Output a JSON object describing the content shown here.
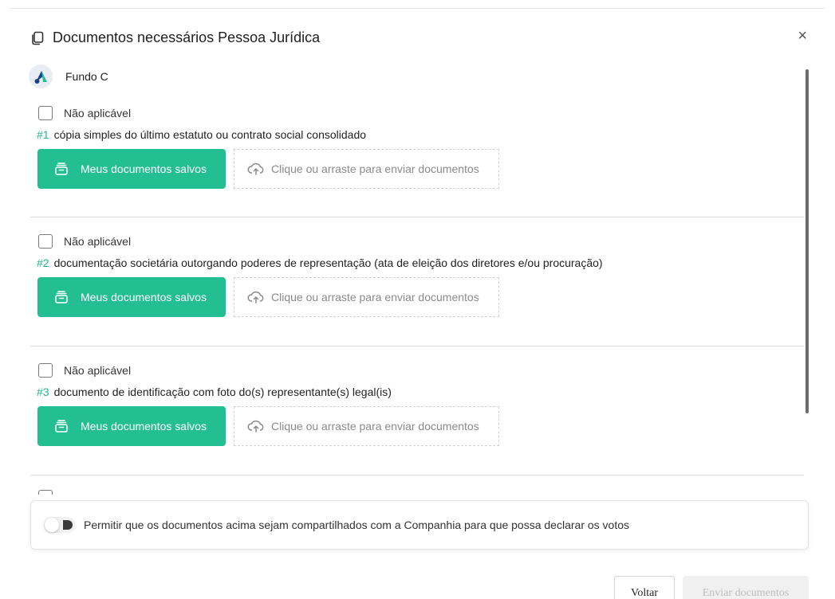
{
  "modal": {
    "title": "Documentos necessários Pessoa Jurídica",
    "close_label": "×"
  },
  "fund": {
    "name": "Fundo C"
  },
  "documents": [
    {
      "not_applicable_label": "Não aplicável",
      "number": "#1",
      "description": "cópia simples do último estatuto ou contrato social consolidado",
      "saved_button_label": "Meus documentos salvos",
      "upload_label": "Clique ou arraste para enviar documentos"
    },
    {
      "not_applicable_label": "Não aplicável",
      "number": "#2",
      "description": "documentação societária outorgando poderes de representação (ata de eleição dos diretores e/ou procuração)",
      "saved_button_label": "Meus documentos salvos",
      "upload_label": "Clique ou arraste para enviar documentos"
    },
    {
      "not_applicable_label": "Não aplicável",
      "number": "#3",
      "description": "documento de identificação com foto do(s) representante(s) legal(is)",
      "saved_button_label": "Meus documentos salvos",
      "upload_label": "Clique ou arraste para enviar documentos"
    }
  ],
  "share": {
    "label": "Permitir que os documentos acima sejam compartilhados com a Companhia para que possa declarar os votos",
    "enabled": false
  },
  "footer": {
    "back_label": "Voltar",
    "send_label": "Enviar documentos"
  },
  "colors": {
    "accent": "#23bf92",
    "number": "#1fb58b"
  }
}
